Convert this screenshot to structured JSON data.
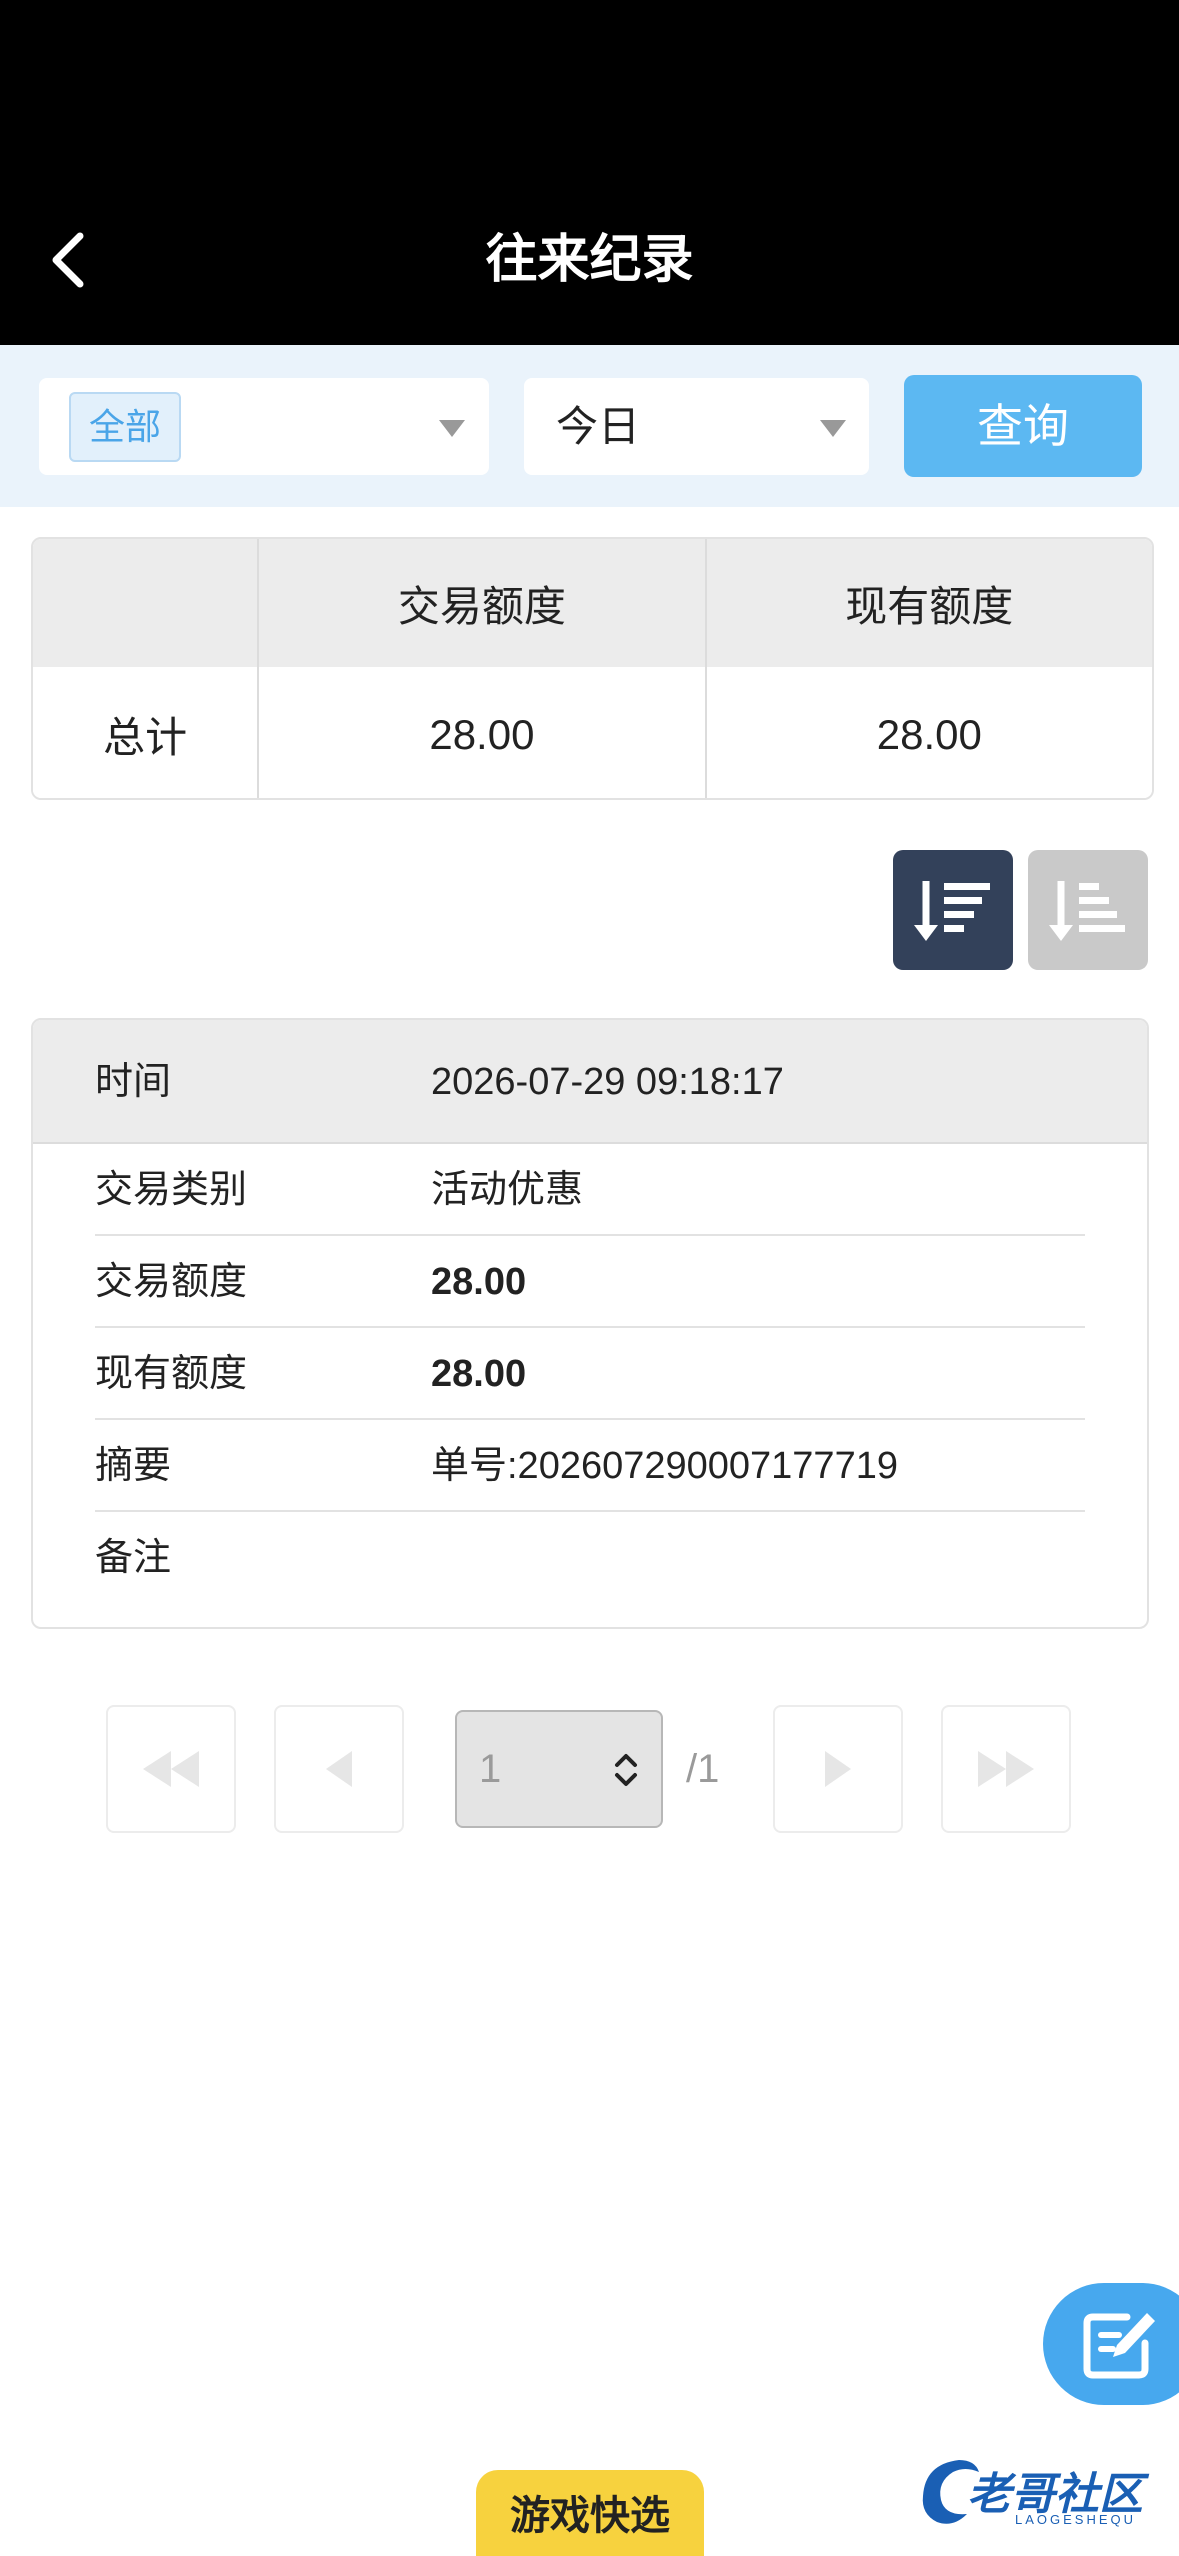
{
  "header": {
    "title": "往来纪录"
  },
  "filter": {
    "type_tag": "全部",
    "date_value": "今日",
    "query_label": "查询"
  },
  "summary": {
    "headers": [
      "",
      "交易额度",
      "现有额度"
    ],
    "row": {
      "label": "总计",
      "trade_amount": "28.00",
      "current_amount": "28.00"
    }
  },
  "record": {
    "time_label": "时间",
    "time_value": "2026-07-29 09:18:17",
    "rows": [
      {
        "label": "交易类别",
        "value": "活动优惠"
      },
      {
        "label": "交易额度",
        "value": "28.00"
      },
      {
        "label": "现有额度",
        "value": "28.00"
      },
      {
        "label": "摘要",
        "value": "单号:202607290007177719"
      },
      {
        "label": "备注",
        "value": ""
      }
    ]
  },
  "pagination": {
    "current_page": "1",
    "total": "/1"
  },
  "bottom": {
    "game_button": "游戏快选",
    "watermark": "老哥社区",
    "watermark_sub": "LAOGESHEQU"
  },
  "colors": {
    "accent": "#5cb8f2",
    "header_bg": "#000000",
    "sort_active": "#33415a",
    "game_button": "#f7d23e"
  }
}
